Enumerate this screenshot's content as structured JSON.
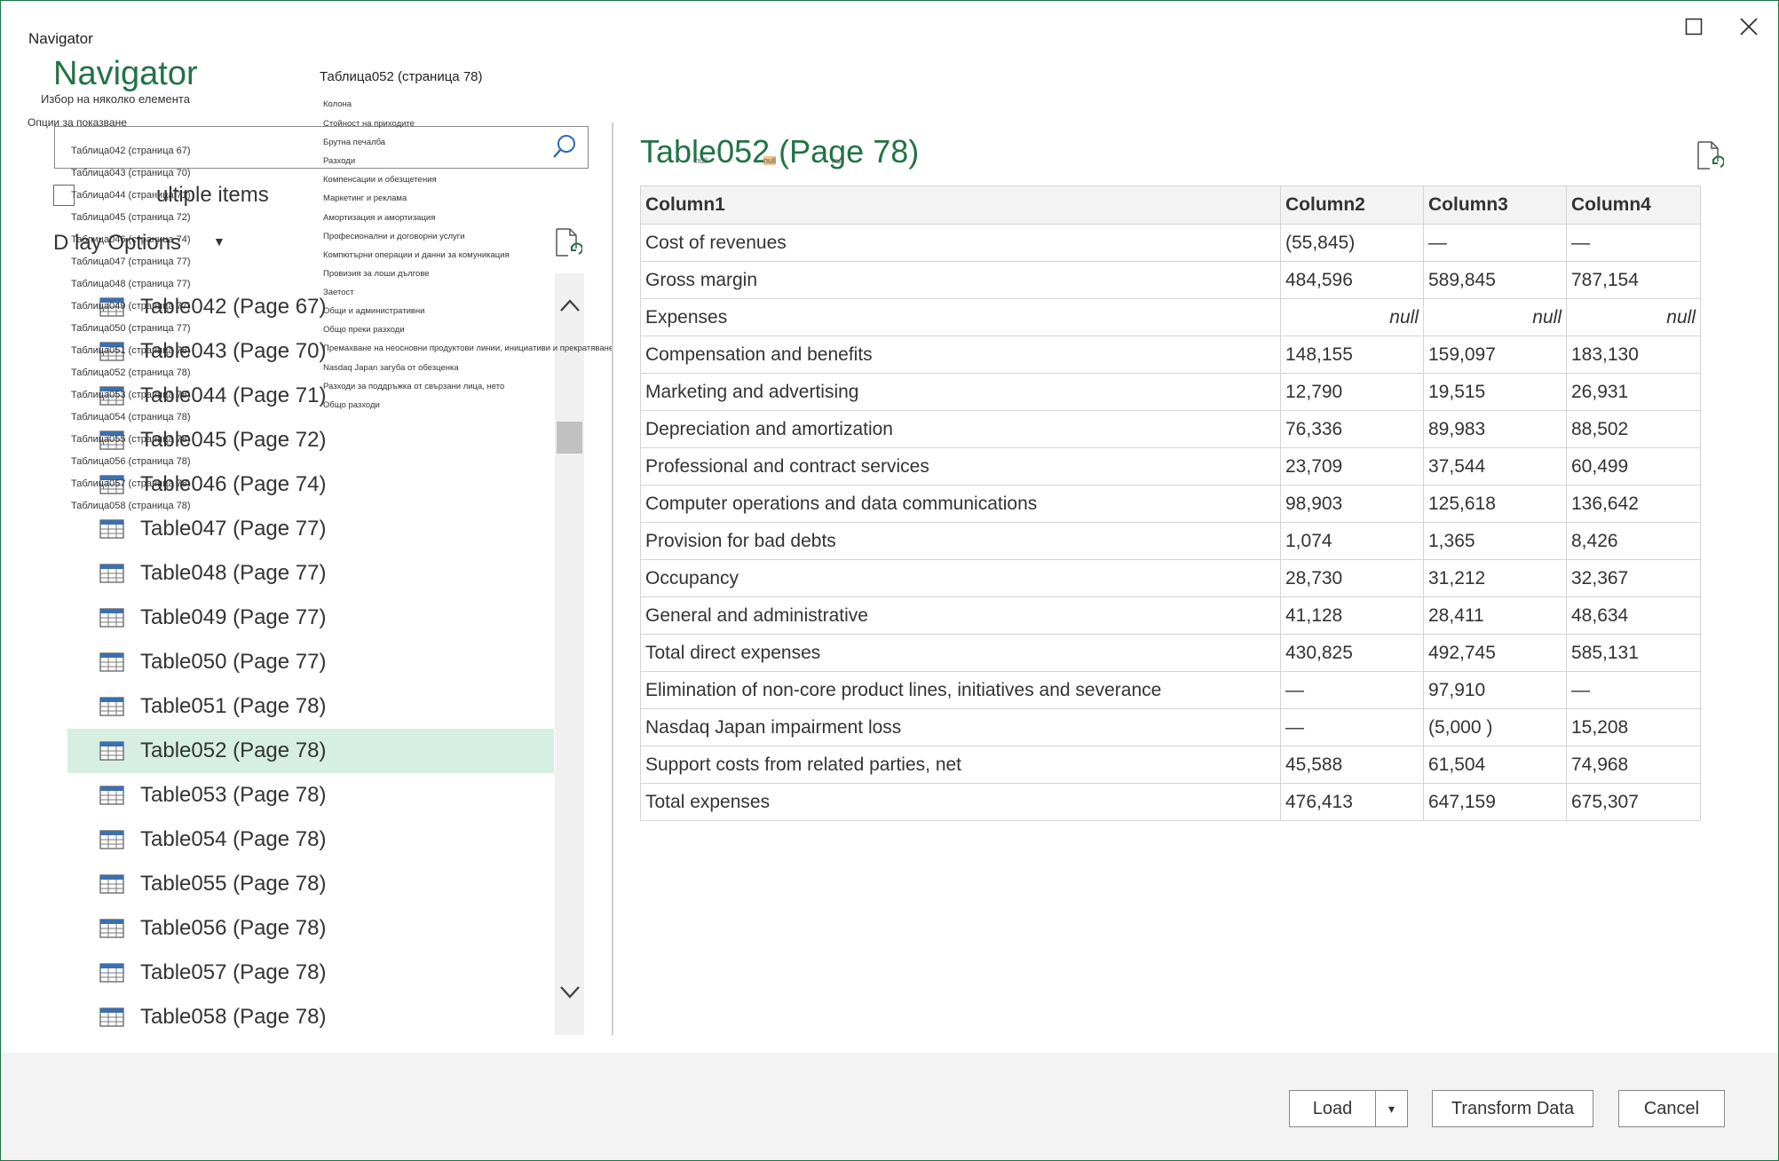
{
  "window": {
    "title": "Navigator",
    "maximize_glyph": "☐",
    "close_glyph": "✕"
  },
  "left_panel": {
    "heading": "Navigator",
    "select_multiple_sub": "Избор на няколко елемента",
    "display_options_sub": "Опции за показване",
    "search_placeholder": "",
    "select_multiple_label": "ultiple items",
    "display_options_label": "D  lay Options",
    "small_items": [
      "Таблица042 (страница 67)",
      "Таблица043 (страница 70)",
      "Таблица044 (страница 71)",
      "Таблица045 (страница 72)",
      "Таблица046 (страница 74)",
      "Таблица047 (страница 77)",
      "Таблица048 (страница 77)",
      "Таблица049 (страница 77)",
      "Таблица050 (страница 77)",
      "Таблица051 (страница 78)",
      "Таблица052 (страница 78)",
      "Таблица053 (страница 78)",
      "Таблица054 (страница 78)",
      "Таблица055 (страница 78)",
      "Таблица056 (страница 78)",
      "Таблица057 (страница 78)",
      "Таблица058 (страница 78)"
    ],
    "items": [
      "Table042 (Page 67)",
      "Table043 (Page 70)",
      "Table044 (Page 71)",
      "Table045 (Page 72)",
      "Table046 (Page 74)",
      "Table047 (Page 77)",
      "Table048 (Page 77)",
      "Table049 (Page 77)",
      "Table050 (Page 77)",
      "Table051 (Page 78)",
      "Table052 (Page 78)",
      "Table053 (Page 78)",
      "Table054 (Page 78)",
      "Table055 (Page 78)",
      "Table056 (Page 78)",
      "Table057 (Page 78)",
      "Table058 (Page 78)"
    ],
    "selected_item": "Table052 (Page 78)"
  },
  "middle_overlay": {
    "title": "Таблица052 (страница 78)",
    "items": [
      "Колона",
      "Стойност на приходите",
      "Брутна печалба",
      "Разходи",
      "Компенсации и обезщетения",
      "Маркетинг и реклама",
      "Амортизация и амортизация",
      "Професионални и договорни услуги",
      "Компютърни операции и данни за комуникация",
      "Провизия за лоши дългове",
      "Заетост",
      "Общи и административни",
      "Общо преки разходи",
      "Премахване на неосновни продуктови линии, инициативи и прекратяване",
      "Nasdaq Japan загуба от обезценка",
      "Разходи за поддръжка от свързани лица, нето",
      "Общо разходи"
    ]
  },
  "preview": {
    "title": "Table052 (Page 78)",
    "null_tags": [
      "null",
      "null",
      "null"
    ],
    "columns": [
      "Column1",
      "Column2",
      "Column3",
      "Column4"
    ],
    "rows": [
      [
        "Cost of revenues",
        "(55,845)",
        "—",
        "—"
      ],
      [
        "Gross margin",
        "484,596",
        "589,845",
        "787,154"
      ],
      [
        "Expenses",
        "null",
        "null",
        "null"
      ],
      [
        "Compensation and benefits",
        "148,155",
        "159,097",
        "183,130"
      ],
      [
        "Marketing and advertising",
        "12,790",
        "19,515",
        "26,931"
      ],
      [
        "Depreciation and amortization",
        "76,336",
        "89,983",
        "88,502"
      ],
      [
        "Professional and contract services",
        "23,709",
        "37,544",
        "60,499"
      ],
      [
        "Computer operations and data communications",
        "98,903",
        "125,618",
        "136,642"
      ],
      [
        "Provision for bad debts",
        "1,074",
        "1,365",
        "8,426"
      ],
      [
        "Occupancy",
        "28,730",
        "31,212",
        "32,367"
      ],
      [
        "General and administrative",
        "41,128",
        "28,411",
        "48,634"
      ],
      [
        "Total direct expenses",
        "430,825",
        "492,745",
        "585,131"
      ],
      [
        "Elimination of non-core product lines, initiatives and severance",
        "—",
        "97,910",
        "—"
      ],
      [
        "Nasdaq Japan impairment loss",
        "—",
        "(5,000 )",
        "15,208"
      ],
      [
        "Support costs from related parties, net",
        "45,588",
        "61,504",
        "74,968"
      ],
      [
        "Total expenses",
        "476,413",
        "647,159",
        "675,307"
      ]
    ]
  },
  "footer": {
    "load_label": "Load",
    "load_dropdown_glyph": "▾",
    "transform_label": "Transform Data",
    "cancel_label": "Cancel"
  },
  "colors": {
    "accent": "#217346",
    "selected_bg": "#d7efe2",
    "footer_bg": "#f3f3f3"
  }
}
